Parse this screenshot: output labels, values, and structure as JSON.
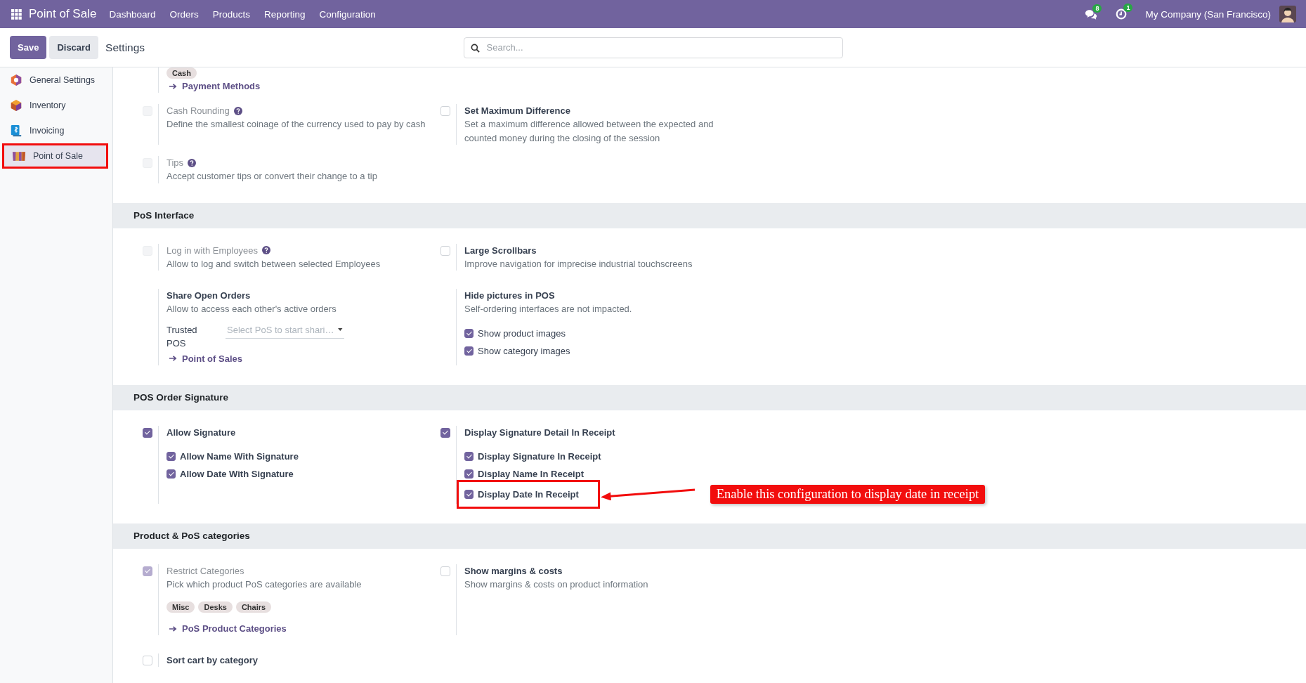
{
  "navbar": {
    "app_name": "Point of Sale",
    "menu": [
      "Dashboard",
      "Orders",
      "Products",
      "Reporting",
      "Configuration"
    ],
    "messages_badge": "8",
    "activities_badge": "1",
    "company": "My Company (San Francisco)"
  },
  "control_panel": {
    "buttons": [
      {
        "label": "Save",
        "kind": "primary"
      },
      {
        "label": "Discard",
        "kind": "secondary"
      }
    ],
    "breadcrumb": "Settings",
    "search": {
      "placeholder": "Search..."
    }
  },
  "sidebar": {
    "items": [
      {
        "label": "General Settings",
        "kind": "general",
        "selected": false,
        "highlighted": false
      },
      {
        "label": "Inventory",
        "kind": "inventory",
        "selected": false,
        "highlighted": false
      },
      {
        "label": "Invoicing",
        "kind": "invoicing",
        "selected": false,
        "highlighted": false
      },
      {
        "label": "Point of Sale",
        "kind": "pos",
        "selected": true,
        "highlighted": true
      }
    ]
  },
  "sections": [
    {
      "rows": [
        [
          {
            "tags": [
              "Cash"
            ],
            "link": "Payment Methods"
          }
        ],
        [
          {
            "checkbox": {
              "checked": false,
              "disabled": true
            },
            "title": "Cash Rounding",
            "disabled": true,
            "help": true,
            "description": "Define the smallest coinage of the currency used to pay by cash"
          },
          {
            "checkbox": {
              "checked": false,
              "disabled": false
            },
            "title": "Set Maximum Difference",
            "disabled": false,
            "description": "Set a maximum difference allowed between the expected and counted money during the closing of the session"
          }
        ],
        [
          {
            "checkbox": {
              "checked": false,
              "disabled": true
            },
            "title": "Tips",
            "disabled": true,
            "help": true,
            "description": "Accept customer tips or convert their change to a tip"
          }
        ]
      ]
    },
    {
      "title": "PoS Interface",
      "rows": [
        [
          {
            "checkbox": {
              "checked": false,
              "disabled": true
            },
            "title": "Log in with Employees",
            "disabled": true,
            "help": true,
            "description": "Allow to log and switch between selected Employees"
          },
          {
            "checkbox": {
              "checked": false,
              "disabled": false
            },
            "title": "Large Scrollbars",
            "disabled": false,
            "description": "Improve navigation for imprecise industrial touchscreens"
          }
        ],
        [
          {
            "title": "Share Open Orders",
            "disabled": false,
            "description": "Allow to access each other's active orders",
            "field": {
              "label": "Trusted POS",
              "placeholder": "Select PoS to start shari…"
            },
            "link": "Point of Sales"
          },
          {
            "title": "Hide pictures in POS",
            "disabled": false,
            "description": "Self-ordering interfaces are not impacted.",
            "subchecks": [
              {
                "label": "Show product images",
                "kind": "plain",
                "checked": true,
                "highlighted": false
              },
              {
                "label": "Show category images",
                "kind": "plain",
                "checked": true,
                "highlighted": false
              }
            ]
          }
        ]
      ]
    },
    {
      "title": "POS Order Signature",
      "rows": [
        [
          {
            "checkbox": {
              "checked": true,
              "disabled": false
            },
            "title": "Allow Signature",
            "disabled": false,
            "subchecks": [
              {
                "label": "Allow Name With Signature",
                "kind": "bold",
                "checked": true,
                "highlighted": false
              },
              {
                "label": "Allow Date With Signature",
                "kind": "bold",
                "checked": true,
                "highlighted": false
              }
            ]
          },
          {
            "checkbox": {
              "checked": true,
              "disabled": false
            },
            "title": "Display Signature Detail In Receipt",
            "disabled": false,
            "subchecks": [
              {
                "label": "Display Signature In Receipt",
                "kind": "bold",
                "checked": true,
                "highlighted": false
              },
              {
                "label": "Display Name In Receipt",
                "kind": "bold",
                "checked": true,
                "highlighted": false
              },
              {
                "label": "Display Date In Receipt",
                "kind": "bold",
                "checked": true,
                "highlighted": true,
                "callout": "Enable this configuration to display date in receipt"
              }
            ]
          }
        ]
      ]
    },
    {
      "title": "Product & PoS categories",
      "rows": [
        [
          {
            "checkbox": {
              "checked": true,
              "disabled": true
            },
            "title": "Restrict Categories",
            "disabled": true,
            "description": "Pick which product PoS categories are available",
            "tags": [
              "Misc",
              "Desks",
              "Chairs"
            ],
            "link": "PoS Product Categories"
          },
          {
            "checkbox": {
              "checked": false,
              "disabled": false
            },
            "title": "Show margins & costs",
            "disabled": false,
            "description": "Show margins & costs on product information"
          }
        ],
        [
          {
            "checkbox": {
              "checked": false,
              "disabled": false
            },
            "title": "Sort cart by category",
            "disabled": false
          }
        ]
      ]
    }
  ]
}
